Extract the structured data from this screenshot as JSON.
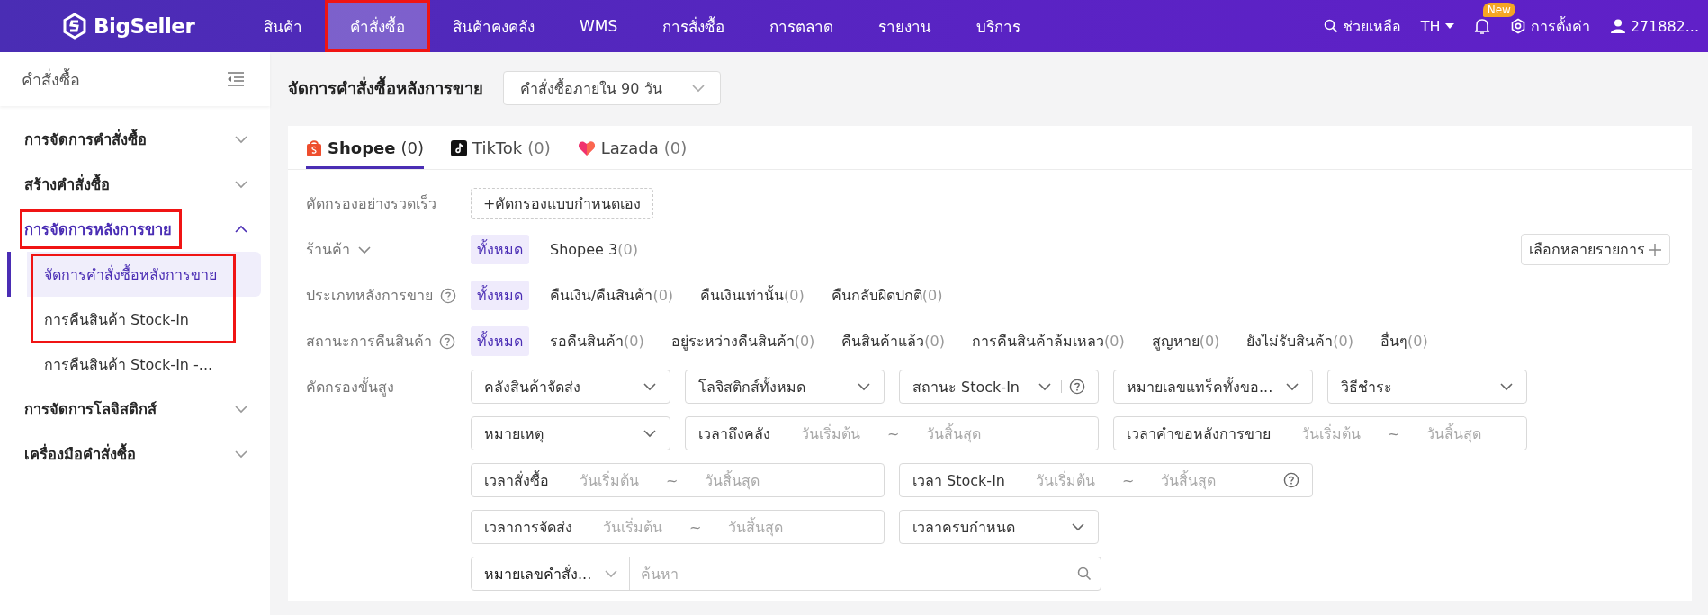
{
  "topbar": {
    "logo": "BigSeller",
    "nav": [
      {
        "label": "สินค้า",
        "selected": false,
        "highlighted": false
      },
      {
        "label": "คำสั่งซื้อ",
        "selected": true,
        "highlighted": true
      },
      {
        "label": "สินค้าคงคลัง",
        "selected": false,
        "highlighted": false
      },
      {
        "label": "WMS",
        "selected": false,
        "highlighted": false
      },
      {
        "label": "การสั่งซื้อ",
        "selected": false,
        "highlighted": false
      },
      {
        "label": "การตลาด",
        "selected": false,
        "highlighted": false
      },
      {
        "label": "รายงาน",
        "selected": false,
        "highlighted": false
      },
      {
        "label": "บริการ",
        "selected": false,
        "highlighted": false
      }
    ],
    "help": "ช่วยเหลือ",
    "language": "TH",
    "notification_badge": "New",
    "settings": "การตั้งค่า",
    "user": "271882..."
  },
  "sidebar": {
    "title": "คำสั่งซื้อ",
    "groups": [
      {
        "label": "การจัดการคำสั่งซื้อ",
        "expanded": false,
        "highlighted": false
      },
      {
        "label": "สร้างคำสั่งซื้อ",
        "expanded": false,
        "highlighted": false
      },
      {
        "label": "การจัดการหลังการขาย",
        "expanded": true,
        "highlighted": true,
        "children": [
          {
            "label": "จัดการคำสั่งซื้อหลังการขาย",
            "selected": true,
            "highlighted": true
          },
          {
            "label": "การคืนสินค้า Stock-In",
            "selected": false,
            "highlighted": true
          },
          {
            "label": "การคืนสินค้า Stock-In -...",
            "selected": false,
            "highlighted": false
          }
        ]
      },
      {
        "label": "การจัดการโลจิสติกส์",
        "expanded": false,
        "highlighted": false
      },
      {
        "label": "เครื่องมือคำสั่งซื้อ",
        "expanded": false,
        "highlighted": false
      }
    ]
  },
  "page": {
    "title": "จัดการคำสั่งซื้อหลังการขาย",
    "period_select": "คำสั่งซื้อภายใน 90 วัน"
  },
  "platform_tabs": [
    {
      "kind": "shopee",
      "label": "Shopee",
      "count": "(0)",
      "selected": true
    },
    {
      "kind": "tiktok",
      "label": "TikTok",
      "count": "(0)",
      "selected": false
    },
    {
      "kind": "lazada",
      "label": "Lazada",
      "count": "(0)",
      "selected": false
    }
  ],
  "quick_filter": {
    "label": "คัดกรองอย่างรวดเร็ว",
    "button": "+คัดกรองแบบกำหนดเอง"
  },
  "filter_rows": [
    {
      "label": "ร้านค้า",
      "kind": "dropdown",
      "multi_select_button": "เลือกหลายรายการ",
      "options": [
        {
          "label": "ทั้งหมด",
          "selected": true
        },
        {
          "label": "Shopee 3",
          "count": "(0)",
          "selected": false
        }
      ]
    },
    {
      "label": "ประเภทหลังการขาย",
      "kind": "help",
      "options": [
        {
          "label": "ทั้งหมด",
          "selected": true
        },
        {
          "label": "คืนเงิน/คืนสินค้า",
          "count": "(0)",
          "selected": false
        },
        {
          "label": "คืนเงินเท่านั้น",
          "count": "(0)",
          "selected": false
        },
        {
          "label": "คืนกลับผิดปกติ",
          "count": "(0)",
          "selected": false
        }
      ]
    },
    {
      "label": "สถานะการคืนสินค้า",
      "kind": "help",
      "options": [
        {
          "label": "ทั้งหมด",
          "selected": true
        },
        {
          "label": "รอคืนสินค้า",
          "count": "(0)",
          "selected": false
        },
        {
          "label": "อยู่ระหว่างคืนสินค้า",
          "count": "(0)",
          "selected": false
        },
        {
          "label": "คืนสินค้าแล้ว",
          "count": "(0)",
          "selected": false
        },
        {
          "label": "การคืนสินค้าล้มเหลว",
          "count": "(0)",
          "selected": false
        },
        {
          "label": "สูญหาย",
          "count": "(0)",
          "selected": false
        },
        {
          "label": "ยังไม่รับสินค้า",
          "count": "(0)",
          "selected": false
        },
        {
          "label": "อื่นๆ",
          "count": "(0)",
          "selected": false
        }
      ]
    }
  ],
  "advanced_filter": {
    "label": "คัดกรองขั้นสูง",
    "fields": [
      {
        "kind": "select",
        "label": "คลังสินค้าจัดส่ง"
      },
      {
        "kind": "select",
        "label": "โลจิสติกส์ทั้งหมด"
      },
      {
        "kind": "select-help",
        "label": "สถานะ Stock-In"
      },
      {
        "kind": "select",
        "label": "หมายเลขแทร็คทั้งขอ..."
      },
      {
        "kind": "select",
        "label": "วิธีชำระ"
      },
      {
        "kind": "select",
        "label": "หมายเหตุ"
      },
      {
        "kind": "daterange",
        "label": "เวลาถึงคลัง",
        "start_placeholder": "วันเริ่มต้น",
        "separator": "~",
        "end_placeholder": "วันสิ้นสุด",
        "help": false
      },
      {
        "kind": "daterange",
        "label": "เวลาคำขอหลังการขาย",
        "start_placeholder": "วันเริ่มต้น",
        "separator": "~",
        "end_placeholder": "วันสิ้นสุด",
        "help": false
      },
      {
        "kind": "daterange",
        "label": "เวลาสั่งซื้อ",
        "start_placeholder": "วันเริ่มต้น",
        "separator": "~",
        "end_placeholder": "วันสิ้นสุด",
        "help": false
      },
      {
        "kind": "daterange",
        "label": "เวลา Stock-In",
        "start_placeholder": "วันเริ่มต้น",
        "separator": "~",
        "end_placeholder": "วันสิ้นสุด",
        "help": true
      },
      {
        "kind": "newline"
      },
      {
        "kind": "daterange",
        "label": "เวลาการจัดส่ง",
        "start_placeholder": "วันเริ่มต้น",
        "separator": "~",
        "end_placeholder": "วันสิ้นสุด",
        "help": false
      },
      {
        "kind": "select",
        "label": "เวลาครบกำหนด"
      },
      {
        "kind": "newline"
      },
      {
        "kind": "search",
        "select_label": "หมายเลขคำสั่ง...",
        "placeholder": "ค้นหา"
      }
    ]
  }
}
